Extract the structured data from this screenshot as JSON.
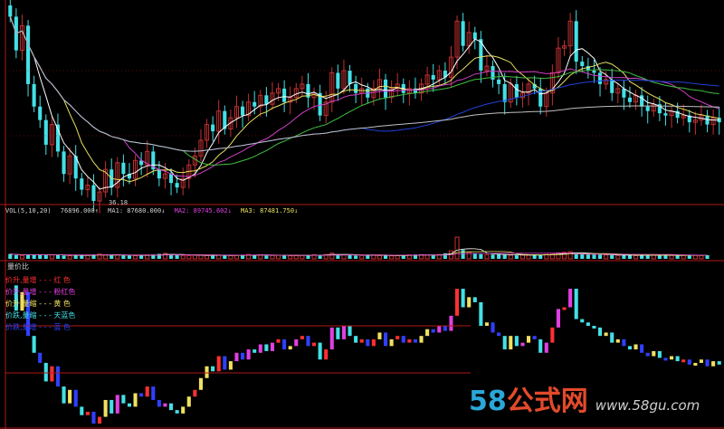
{
  "colors": {
    "bg": "#000000",
    "divider": "#b01818",
    "candle_up": "#c03030",
    "candle_down": "#43e0e6",
    "ma5": "#ffffff",
    "ma10": "#e8e060",
    "ma20": "#d040c8",
    "ma30": "#40c040",
    "ma60": "#2040d8",
    "ma120": "#c0c0c0",
    "vol_up": "#d03030",
    "vol_down": "#43e0e6",
    "vpr_red": "#ff3030",
    "vpr_pink": "#e040e0",
    "vpr_yellow": "#f0e060",
    "vpr_cyan": "#43e0e6",
    "vpr_blue": "#3040ff"
  },
  "volume_header": {
    "title": "VOL(5,10,20)",
    "vol": "76896.000↑",
    "ma1": "MA1: 87680.000↓",
    "ma2": "MA2: 89745.602↓",
    "ma3": "MA3: 87481.750↓"
  },
  "low_label": "36.18",
  "vpr": {
    "title": "量价比",
    "legend": [
      {
        "text": "价升,量增 - - - 红  色",
        "color": "#ff3030"
      },
      {
        "text": "价升,量增 - - - 粉红色",
        "color": "#e040e0"
      },
      {
        "text": "价升,量缩 - - - 黄  色",
        "color": "#f0e060"
      },
      {
        "text": "价跌,量缩 - - - 天蓝色",
        "color": "#43e0e6"
      },
      {
        "text": "价跌,量增 - - - 蓝  色",
        "color": "#3040ff"
      }
    ]
  },
  "watermark": {
    "num": "58",
    "cn": "公式网",
    "url": "www.58gu.com"
  },
  "chart_data": [
    {
      "type": "candlestick",
      "title": "",
      "close": [
        44.0,
        42.5,
        43.6,
        41.0,
        40.0,
        39.4,
        38.3,
        39.2,
        38.0,
        37.0,
        37.8,
        36.8,
        36.3,
        36.5,
        35.8,
        36.2,
        37.2,
        36.4,
        37.5,
        37.0,
        36.8,
        37.6,
        37.4,
        38.0,
        37.2,
        36.8,
        37.0,
        36.6,
        36.4,
        36.8,
        37.4,
        37.8,
        38.5,
        39.2,
        38.9,
        39.8,
        39.0,
        39.5,
        40.0,
        39.6,
        40.2,
        40.0,
        40.5,
        40.1,
        40.6,
        40.8,
        40.2,
        40.4,
        40.8,
        41.0,
        40.4,
        40.6,
        39.6,
        40.2,
        41.5,
        40.8,
        41.6,
        41.0,
        40.6,
        40.8,
        40.4,
        40.8,
        41.2,
        40.4,
        40.8,
        41.0,
        40.6,
        40.8,
        40.6,
        41.0,
        41.4,
        41.2,
        41.6,
        41.3,
        42.2,
        43.8,
        42.7,
        43.3,
        43.0,
        41.6,
        41.8,
        41.2,
        41.0,
        40.2,
        41.0,
        40.4,
        40.6,
        41.0,
        40.8,
        40.0,
        40.6,
        41.5,
        42.6,
        42.7,
        43.8,
        42.0,
        41.8,
        41.6,
        41.5,
        41.0,
        41.2,
        40.6,
        40.8,
        40.4,
        40.2,
        40.5,
        40.0,
        39.8,
        40.1,
        39.7,
        39.6,
        39.8,
        39.5,
        39.6,
        39.3,
        39.4,
        39.6,
        39.2,
        39.5,
        39.3
      ],
      "ma_lines": [
        "MA5",
        "MA10",
        "MA20",
        "MA30",
        "MA60",
        "MA120"
      ],
      "annotations": [
        "36.18"
      ]
    },
    {
      "type": "bar",
      "title": "VOL(5,10,20)",
      "series_count": 118,
      "notable": {
        "spike_index": 75,
        "relative_height": 4.5
      },
      "values": [
        0.45,
        0.35,
        0.32,
        0.4,
        0.38,
        0.42,
        0.34,
        0.36,
        0.38,
        0.3,
        0.28,
        0.36,
        0.3,
        0.34,
        0.4,
        0.44,
        0.36,
        0.34,
        0.38,
        0.32,
        0.3,
        0.28,
        0.34,
        0.36,
        0.4,
        0.46,
        0.5,
        0.36,
        0.34,
        0.32,
        0.3,
        0.38,
        0.34,
        0.3,
        0.28,
        0.34,
        0.36,
        0.3,
        0.32,
        0.34,
        0.4,
        0.36,
        0.38,
        0.3,
        0.32,
        0.34,
        0.36,
        0.28,
        0.3,
        0.32,
        0.34,
        0.38,
        0.36,
        0.4,
        0.52,
        0.36,
        0.38,
        0.34,
        0.3,
        0.32,
        0.34,
        0.36,
        0.3,
        0.32,
        0.28,
        0.3,
        0.34,
        0.36,
        0.4,
        0.38,
        0.34,
        0.36,
        0.4,
        0.5,
        0.74,
        2.0,
        0.82,
        0.6,
        0.48,
        0.44,
        0.38,
        0.4,
        0.42,
        0.36,
        0.34,
        0.32,
        0.36,
        0.34,
        0.38,
        0.36,
        0.4,
        0.48,
        0.56,
        0.6,
        0.66,
        0.5,
        0.46,
        0.44,
        0.4,
        0.38,
        0.36,
        0.34,
        0.32,
        0.36,
        0.34,
        0.3,
        0.32,
        0.36,
        0.34,
        0.3,
        0.34,
        0.32,
        0.3,
        0.34,
        0.36,
        0.32,
        0.3,
        0.34
      ]
    },
    {
      "type": "bar",
      "title": "量价比",
      "series": [
        "红色: 价升,量增",
        "粉红色: 价升,量增",
        "黄色: 价升,量缩",
        "天蓝色: 价跌,量缩",
        "蓝色: 价跌,量增"
      ]
    }
  ]
}
